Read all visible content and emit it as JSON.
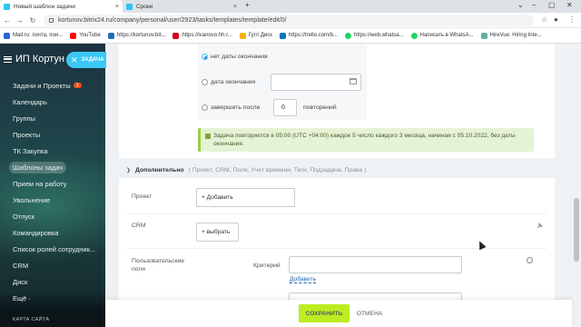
{
  "browser": {
    "tabs": [
      {
        "title": "Новый шаблон задачи",
        "close": "×"
      },
      {
        "title": "Сроки",
        "close": "×"
      }
    ],
    "new_tab": "+",
    "window_controls": [
      "⌄",
      "–",
      "▢",
      "✕"
    ],
    "url": "kortunov.bitrix24.ru/company/personal/user/2923/tasks/templates/template/edit/0/",
    "nav": [
      "←",
      "→",
      "↻"
    ],
    "bookmarks": [
      {
        "label": "Mail.ru: почта, пои...",
        "color": "#2b66d3"
      },
      {
        "label": "YouTube",
        "color": "#ff0000"
      },
      {
        "label": "https://kortunov.bit...",
        "color": "#1d6fb8"
      },
      {
        "label": "https://ivanovo.hh.r...",
        "color": "#d6001c"
      },
      {
        "label": "Гугл Диск",
        "color": "#f4b400"
      },
      {
        "label": "https://trello.com/b...",
        "color": "#0079bf"
      },
      {
        "label": "https://web.whatsa...",
        "color": "#25d366"
      },
      {
        "label": "Написать в WhatsA...",
        "color": "#25d366"
      },
      {
        "label": "HireVue: Hiring Inte...",
        "color": "#5fb3a1"
      }
    ]
  },
  "sidebar": {
    "company": "ИП Кортун",
    "items": [
      {
        "label": "Задачи и Проекты",
        "badge": "1"
      },
      {
        "label": "Календарь"
      },
      {
        "label": "Группы"
      },
      {
        "label": "Проекты"
      },
      {
        "label": "ТК Закупка"
      },
      {
        "label": "Шаблоны задач"
      },
      {
        "label": "Прием на работу"
      },
      {
        "label": "Увольнение"
      },
      {
        "label": "Отпуск"
      },
      {
        "label": "Командировка"
      },
      {
        "label": "Список ролей сотрудник..."
      },
      {
        "label": "CRM"
      },
      {
        "label": "Диск"
      },
      {
        "label": "Ещё ·"
      }
    ],
    "active_index": 5,
    "sitemap": "КАРТА САЙТА"
  },
  "task_panel_button": "ЗАДАЧА",
  "repeat": {
    "options": [
      "нет даты окончания",
      "дата окончания",
      "завершить после"
    ],
    "selected": 0,
    "count_value": "0",
    "count_suffix": "повторений"
  },
  "info_text": "Задача повторяется в 05:00 (UTC +04:00) каждое 5 число каждого 3 месяца, начиная с 05.10.2022, без даты окончания.",
  "additional": {
    "title": "Дополнительно",
    "links": "( Проект, CRM, Поля, Учет времени, Теги, Подзадача, Права )"
  },
  "fields": {
    "project_label": "Проект",
    "project_button": "+ Добавить",
    "crm_label": "CRM",
    "crm_button": "+ выбрать",
    "user_fields_label": "Пользовательские поля",
    "criterion_label": "Критерий",
    "add_link": "Добавить"
  },
  "footer": {
    "save": "СОХРАНИТЬ",
    "cancel": "ОТМЕНА"
  }
}
